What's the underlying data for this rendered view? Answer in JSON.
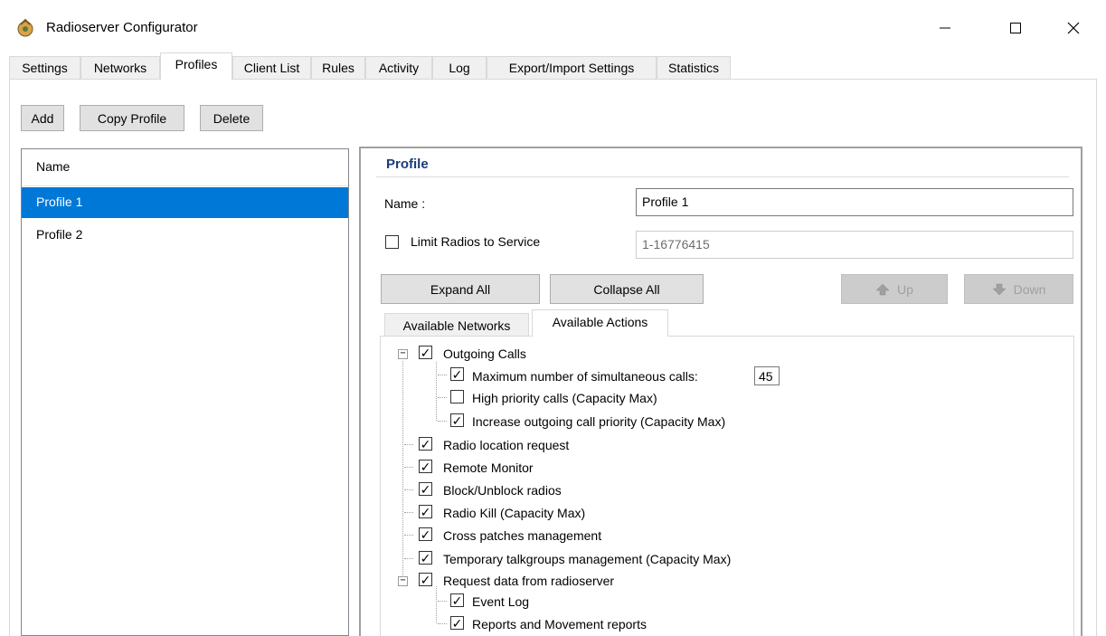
{
  "window": {
    "title": "Radioserver Configurator",
    "icon": "radioserver-app-icon",
    "controls": {
      "minimize": "—",
      "maximize": "☐",
      "close": "✕"
    }
  },
  "tabs": [
    {
      "label": "Settings",
      "active": false
    },
    {
      "label": "Networks",
      "active": false
    },
    {
      "label": "Profiles",
      "active": true
    },
    {
      "label": "Client List",
      "active": false
    },
    {
      "label": "Rules",
      "active": false
    },
    {
      "label": "Activity",
      "active": false
    },
    {
      "label": "Log",
      "active": false
    },
    {
      "label": "Export/Import Settings",
      "active": false
    },
    {
      "label": "Statistics",
      "active": false
    }
  ],
  "toolbar": {
    "add": "Add",
    "copy_profile": "Copy Profile",
    "delete": "Delete"
  },
  "profile_list": {
    "header": "Name",
    "items": [
      {
        "label": "Profile 1",
        "selected": true
      },
      {
        "label": "Profile 2",
        "selected": false
      }
    ]
  },
  "profile": {
    "group_title": "Profile",
    "name_label": "Name :",
    "name_value": "Profile 1",
    "limit_label": "Limit Radios to Service",
    "limit_checked": false,
    "limit_value": "1-16776415",
    "expand_all": "Expand All",
    "collapse_all": "Collapse All",
    "up": "Up",
    "down": "Down"
  },
  "inner_tabs": [
    {
      "label": "Available Networks",
      "active": false
    },
    {
      "label": "Available Actions",
      "active": true
    }
  ],
  "actions_tree": {
    "outgoing_calls": "Outgoing Calls",
    "max_simultaneous": "Maximum number of simultaneous calls:",
    "max_simultaneous_value": "45",
    "high_priority": "High priority calls (Capacity Max)",
    "increase_priority": "Increase outgoing call priority (Capacity Max)",
    "location_request": "Radio location request",
    "remote_monitor": "Remote Monitor",
    "block_unblock": "Block/Unblock radios",
    "radio_kill": "Radio Kill (Capacity Max)",
    "cross_patches": "Cross patches management",
    "temp_talkgroups": "Temporary talkgroups management (Capacity Max)",
    "request_data": "Request data from radioserver",
    "event_log": "Event Log",
    "reports": "Reports and Movement reports"
  },
  "colors": {
    "selection": "#0078d7",
    "group_title": "#1a3c7a"
  }
}
